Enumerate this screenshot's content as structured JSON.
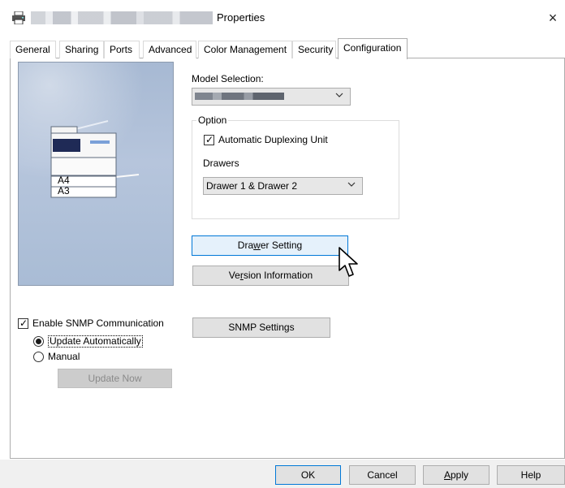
{
  "window": {
    "title_suffix": "Properties",
    "close_glyph": "×"
  },
  "tabs": [
    {
      "label": "General"
    },
    {
      "label": "Sharing"
    },
    {
      "label": "Ports"
    },
    {
      "label": "Advanced"
    },
    {
      "label": "Color Management"
    },
    {
      "label": "Security"
    },
    {
      "label": "Configuration",
      "active": true
    }
  ],
  "preview": {
    "tray_labels": [
      "A4",
      "A3"
    ]
  },
  "config": {
    "model_selection_label": "Model Selection:",
    "option_legend": "Option",
    "automatic_duplexing_label": "Automatic Duplexing Unit",
    "automatic_duplexing_checked": true,
    "drawers_label": "Drawers",
    "drawers_value": "Drawer 1 & Drawer 2",
    "drawer_setting_pre": "Dra",
    "drawer_setting_mnemonic": "w",
    "drawer_setting_post": "er Setting",
    "version_info_pre": "Ve",
    "version_info_mnemonic": "r",
    "version_info_post": "sion Information",
    "snmp_settings_label": "SNMP Settings"
  },
  "snmp": {
    "enable_label": "Enable SNMP Communication",
    "enable_checked": true,
    "update_auto_label": "Update Automatically",
    "update_auto_selected": true,
    "manual_label": "Manual",
    "update_now_label": "Update Now"
  },
  "footer": {
    "ok_label": "OK",
    "cancel_label": "Cancel",
    "apply_pre": "",
    "apply_mnemonic": "A",
    "apply_post": "pply",
    "help_label": "Help"
  },
  "colors": {
    "focus_blue": "#0078d7",
    "preview_bg": "#b0c1da"
  }
}
